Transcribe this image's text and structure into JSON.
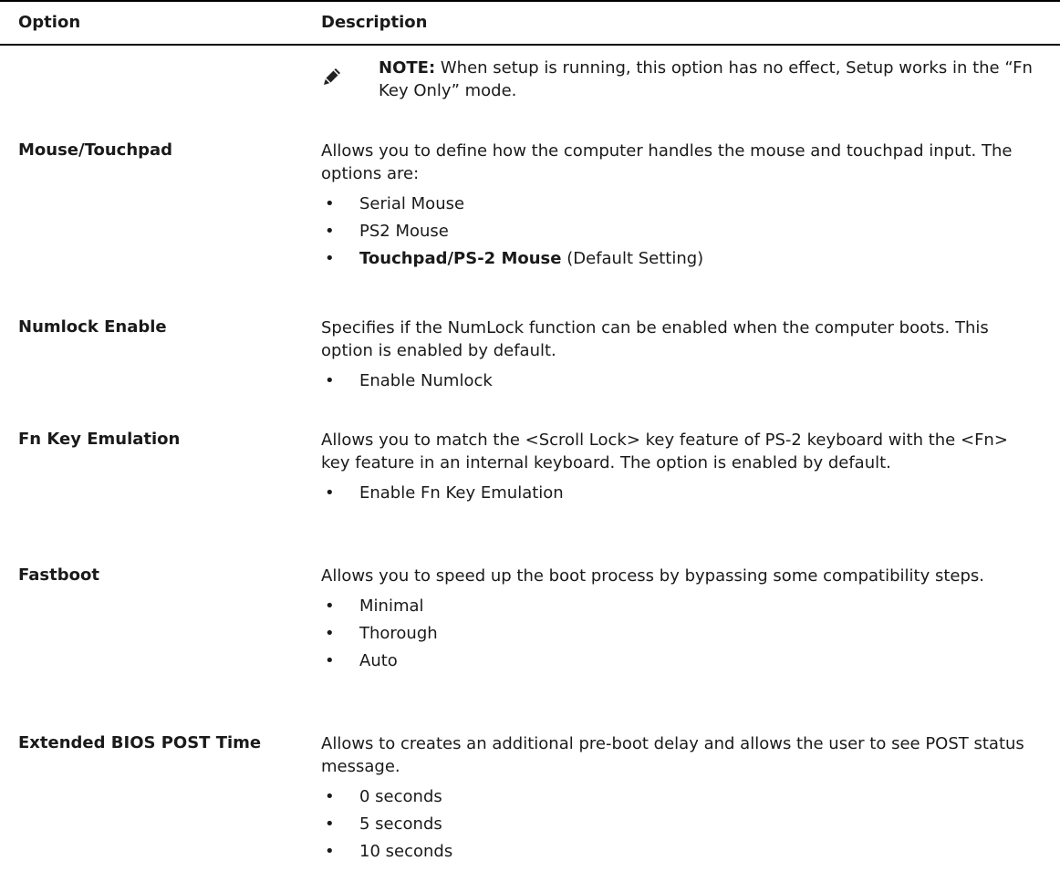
{
  "header": {
    "option": "Option",
    "description": "Description"
  },
  "note": {
    "label": "NOTE:",
    "text": " When setup is running, this option has no effect, Setup works in the “Fn Key Only” mode."
  },
  "rows": [
    {
      "option": "Mouse/Touchpad",
      "description": "Allows you to define how the computer handles the mouse and touchpad input. The options are:",
      "bullets": [
        "Serial Mouse",
        "PS2 Mouse"
      ],
      "bold_bullet": {
        "bold": "Touchpad/PS-2 Mouse",
        "rest": " (Default Setting)"
      }
    },
    {
      "option": "Numlock Enable",
      "description": "Specifies if the NumLock function can be enabled when the computer boots. This option is enabled by default.",
      "bullets": [
        "Enable Numlock"
      ]
    },
    {
      "option": "Fn Key Emulation",
      "description": "Allows you to match the <Scroll Lock> key feature of PS-2 keyboard with the <Fn> key feature in an internal keyboard. The option is enabled by default.",
      "bullets": [
        "Enable Fn Key Emulation"
      ]
    },
    {
      "option": "Fastboot",
      "description": "Allows you to speed up the boot process by bypassing some compatibility steps.",
      "bullets": [
        "Minimal",
        "Thorough",
        "Auto"
      ]
    },
    {
      "option": "Extended BIOS POST Time",
      "description": "Allows to creates an additional pre-boot delay and allows the user to see POST status message.",
      "bullets": [
        "0 seconds",
        "5 seconds",
        "10 seconds"
      ]
    }
  ]
}
